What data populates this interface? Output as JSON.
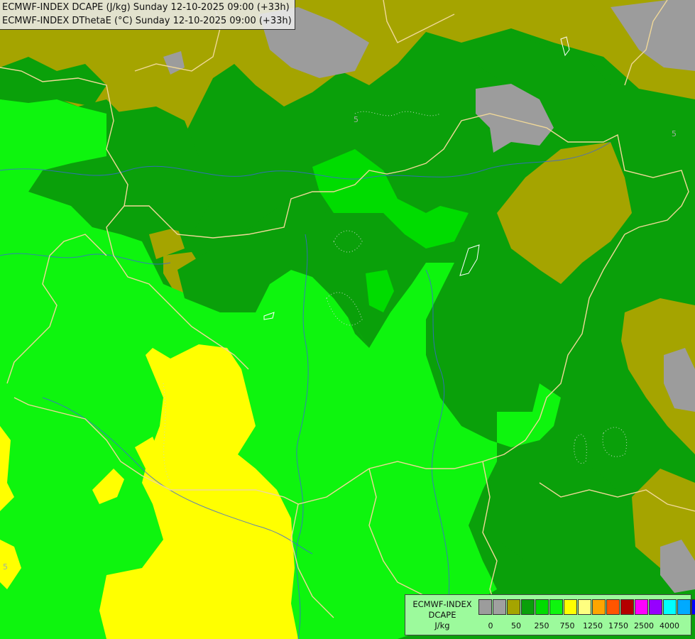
{
  "header": {
    "line1": "ECMWF-INDEX DCAPE (J/kg) Sunday 12-10-2025 09:00 (+33h)",
    "line2": "ECMWF-INDEX DThetaE (°C) Sunday 12-10-2025 09:00 (+33h)"
  },
  "map_colors": {
    "gray": "#9c9c9c",
    "olive": "#a5a400",
    "dark_green": "#0aa00a",
    "green": "#00dc00",
    "bright_green": "#0ef50e",
    "yellow": "#ffff00",
    "border": "#f0d898",
    "river": "#3c64dc"
  },
  "contour_labels": [
    "5",
    "5",
    "5"
  ],
  "legend": {
    "title_line1": "ECMWF-INDEX",
    "title_line2": "DCAPE",
    "unit": "J/kg",
    "swatches": [
      "#9c9c9c",
      "#a0a0a0",
      "#a5a400",
      "#0aa00a",
      "#00dc00",
      "#0ef50e",
      "#ffff00",
      "#ffff80",
      "#ffa500",
      "#ff5500",
      "#b40000",
      "#ff00ff",
      "#9600ff",
      "#00ffff",
      "#00aaff",
      "#0000ff",
      "#00008b"
    ],
    "ticks": [
      "0",
      "50",
      "250",
      "750",
      "1250",
      "1750",
      "2500",
      "4000"
    ]
  }
}
